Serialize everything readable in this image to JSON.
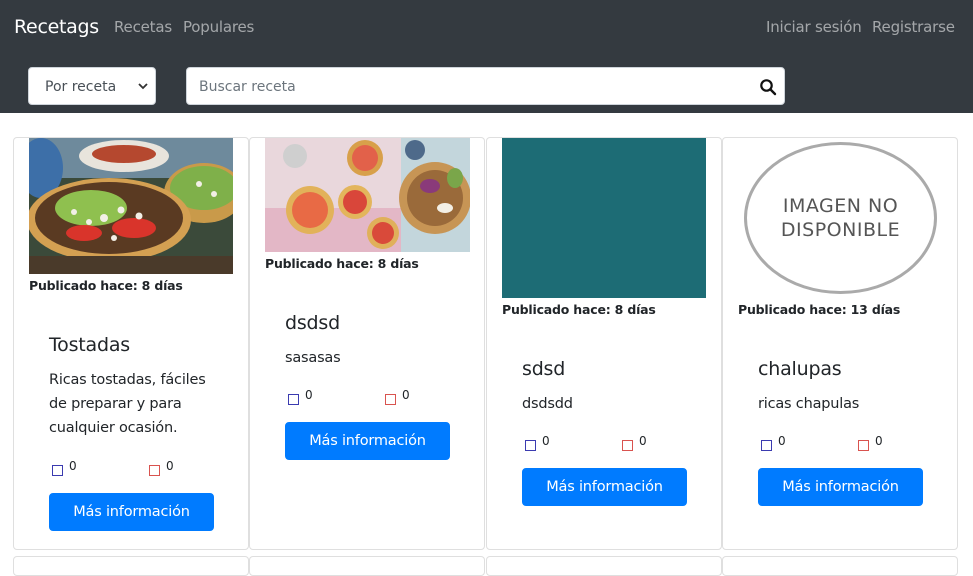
{
  "navbar": {
    "brand": "Recetags",
    "links": [
      "Recetas",
      "Populares"
    ],
    "login": "Iniciar sesión",
    "register": "Registrarse"
  },
  "search": {
    "filter_selected": "Por receta",
    "placeholder": "Buscar receta"
  },
  "cards": [
    {
      "published": "Publicado hace: 8 días",
      "title": "Tostadas",
      "description": "Ricas tostadas, fáciles de preparar y para cualquier ocasión.",
      "likes": "0",
      "dislikes": "0",
      "button": "Más información"
    },
    {
      "published": "Publicado hace: 8 días",
      "title": "dsdsd",
      "description": "sasasas",
      "likes": "0",
      "dislikes": "0",
      "button": "Más información"
    },
    {
      "published": "Publicado hace: 8 días",
      "title": "sdsd",
      "description": "dsdsdd",
      "likes": "0",
      "dislikes": "0",
      "button": "Más información"
    },
    {
      "published": "Publicado hace: 13 días",
      "title": "chalupas",
      "description": "ricas chapulas",
      "likes": "0",
      "dislikes": "0",
      "button": "Más información",
      "image_placeholder": "IMAGEN NO DISPONIBLE"
    }
  ],
  "colors": {
    "navbar": "#343a40",
    "primary": "#007bff",
    "like": "#3b3bb0",
    "dislike": "#d9534f",
    "teal_image": "#1f6f78"
  }
}
